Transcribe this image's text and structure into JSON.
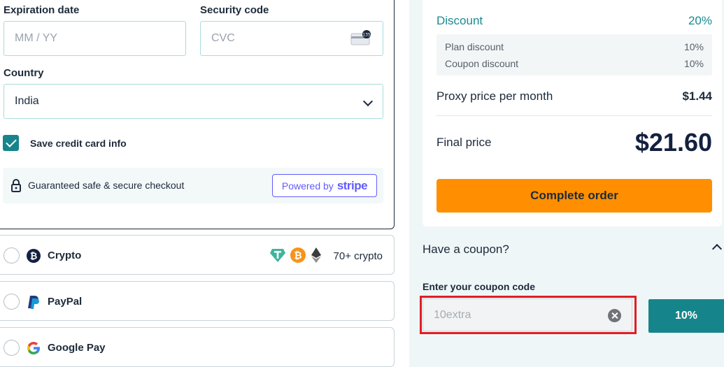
{
  "card_form": {
    "expiration_label": "Expiration date",
    "expiration_placeholder": "MM / YY",
    "security_label": "Security code",
    "security_placeholder": "CVC",
    "cvc_icon": "card-cvc-icon",
    "country_label": "Country",
    "country_value": "India",
    "save_card_label": "Save credit card info",
    "save_card_checked": true,
    "secure_text": "Guaranteed safe & secure checkout",
    "powered_by": "Powered by",
    "stripe_brand": "stripe"
  },
  "payment_options": [
    {
      "label": "Crypto",
      "icon": "bitcoin-icon",
      "extra": "70+ crypto"
    },
    {
      "label": "PayPal",
      "icon": "paypal-icon"
    },
    {
      "label": "Google Pay",
      "icon": "google-icon"
    }
  ],
  "summary": {
    "discount_label": "Discount",
    "discount_value": "20%",
    "plan_discount_label": "Plan discount",
    "plan_discount_value": "10%",
    "coupon_discount_label": "Coupon discount",
    "coupon_discount_value": "10%",
    "proxy_price_label": "Proxy price per month",
    "proxy_price_value": "$1.44",
    "final_price_label": "Final price",
    "final_price_value": "$21.60",
    "complete_button": "Complete order"
  },
  "coupon": {
    "question": "Have a coupon?",
    "input_label": "Enter your coupon code",
    "input_value": "10extra",
    "apply_result": "10%"
  },
  "colors": {
    "teal": "#16858b",
    "orange": "#ff8f00",
    "highlight_red": "#e01e25",
    "stripe_purple": "#635bff"
  }
}
